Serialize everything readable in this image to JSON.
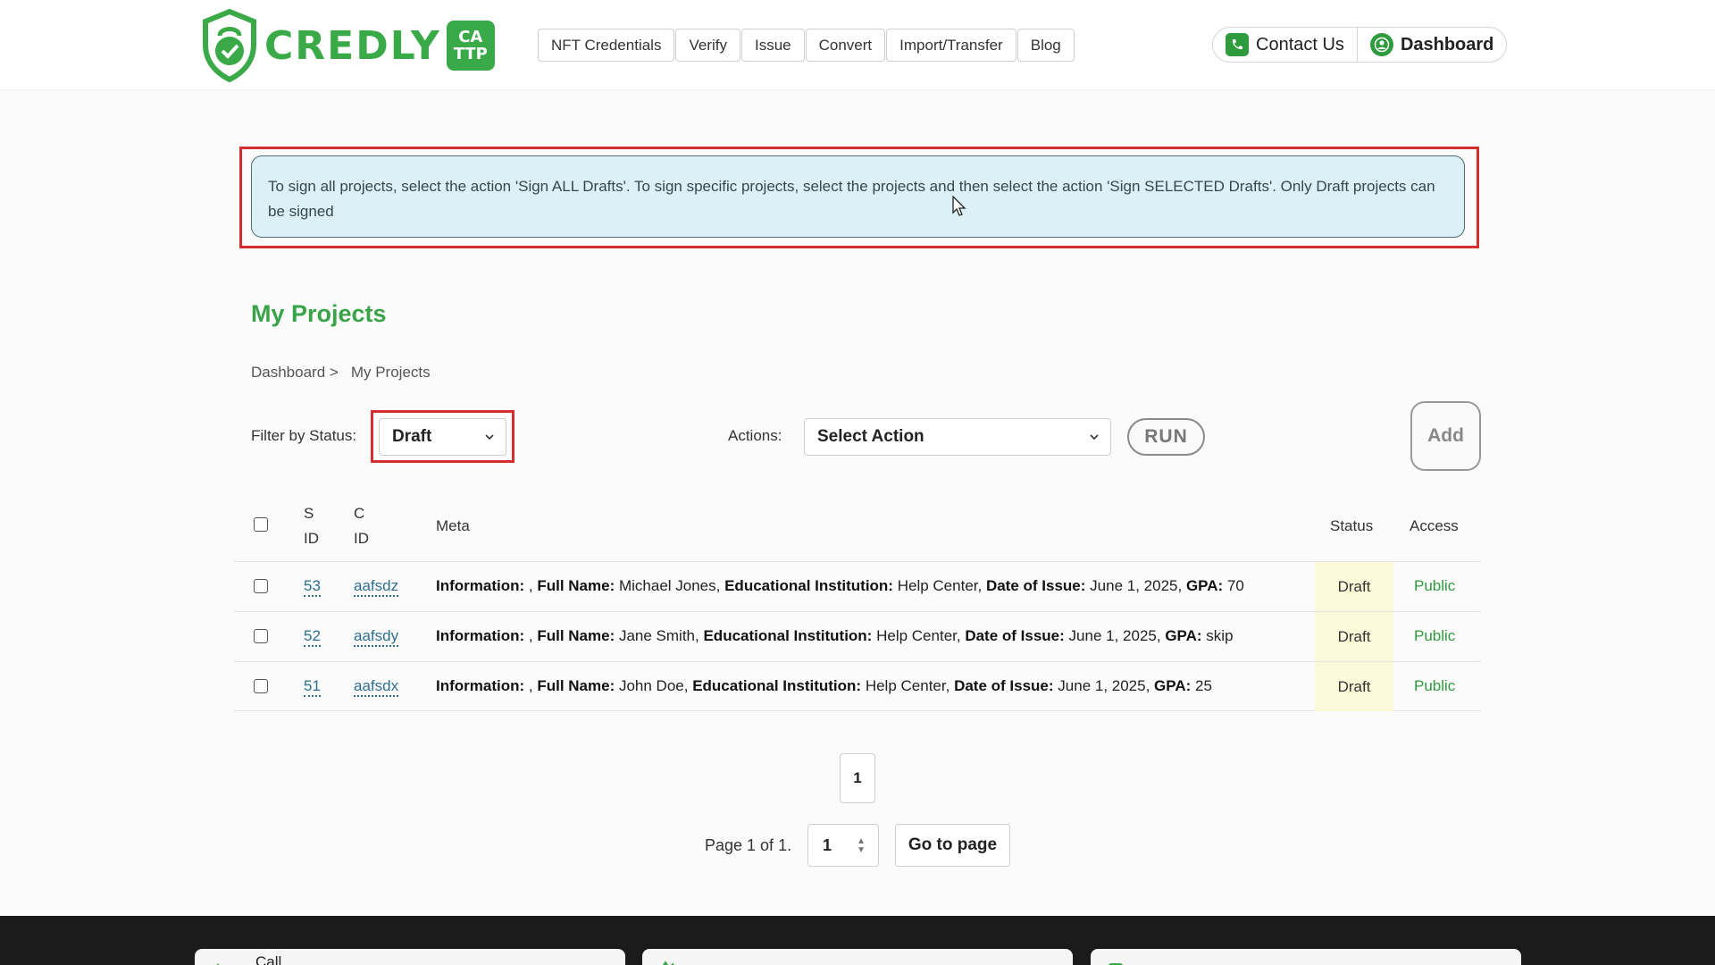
{
  "header": {
    "logo": {
      "wordmark": "CREDLY",
      "badge_line1": "CA",
      "badge_line2": "TTP"
    },
    "nav": [
      "NFT Credentials",
      "Verify",
      "Issue",
      "Convert",
      "Import/Transfer",
      "Blog"
    ],
    "contact_label": "Contact Us",
    "dashboard_label": "Dashboard"
  },
  "notice": "To sign all projects, select the action 'Sign ALL Drafts'. To sign specific projects, select the projects and then select the action 'Sign SELECTED Drafts'. Only Draft projects can be signed",
  "page_title": "My Projects",
  "breadcrumb": {
    "parent": "Dashboard >",
    "current": "My Projects"
  },
  "filter": {
    "label": "Filter by Status:",
    "value": "Draft"
  },
  "actions": {
    "label": "Actions:",
    "value": "Select Action"
  },
  "run_label": "RUN",
  "add_label": "Add",
  "table": {
    "headers": {
      "sid_line1": "S",
      "sid_line2": "ID",
      "cid_line1": "C",
      "cid_line2": "ID",
      "meta": "Meta",
      "status": "Status",
      "access": "Access"
    },
    "rows": [
      {
        "sid": "53",
        "cid": "aafsdz",
        "full_name": "Michael Jones",
        "institution": "Help Center",
        "date": "June 1, 2025",
        "gpa": "70",
        "status": "Draft",
        "access": "Public"
      },
      {
        "sid": "52",
        "cid": "aafsdy",
        "full_name": "Jane Smith",
        "institution": "Help Center",
        "date": "June 1, 2025",
        "gpa": "skip",
        "status": "Draft",
        "access": "Public"
      },
      {
        "sid": "51",
        "cid": "aafsdx",
        "full_name": "John Doe",
        "institution": "Help Center",
        "date": "June 1, 2025",
        "gpa": "25",
        "status": "Draft",
        "access": "Public"
      }
    ],
    "meta_labels": {
      "information": "Information:",
      "full_name": "Full Name:",
      "institution": "Educational Institution:",
      "date": "Date of Issue:",
      "gpa": "GPA:"
    }
  },
  "pagination": {
    "current_page": "1",
    "page_of": "Page 1 of 1.",
    "input_value": "1",
    "goto_label": "Go to page"
  },
  "footer": {
    "card1_label": "Call"
  },
  "colors": {
    "brand_green": "#3aa947",
    "highlight_red": "#d32f2f",
    "notice_bg": "#dcf1f5",
    "status_bg": "#fbf9d7"
  }
}
